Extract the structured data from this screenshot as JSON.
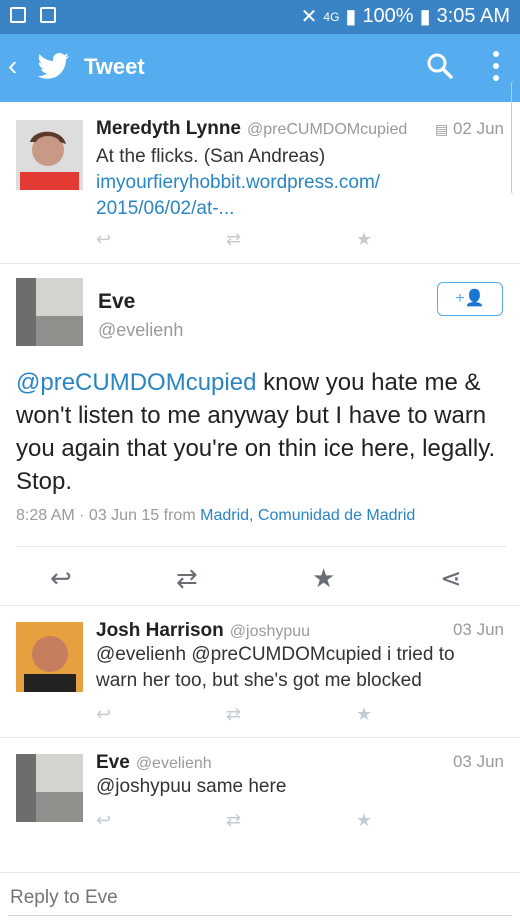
{
  "status": {
    "signal": "4G",
    "battery": "100%",
    "time": "3:05 AM"
  },
  "header": {
    "title": "Tweet"
  },
  "tweets": [
    {
      "name": "Meredyth Lynne",
      "handle": "@preCUMDOMcupied",
      "date": "02 Jun",
      "text": "At the flicks. (San Andreas)",
      "link1": "imyourfieryhobbit.wordpress.com/",
      "link2": "2015/06/02/at-..."
    }
  ],
  "main": {
    "name": "Eve",
    "handle": "@evelienh",
    "mention": "@preCUMDOMcupied",
    "text": " know you hate me & won't listen to me anyway but I  have to warn you again that you're on thin ice here, legally. Stop.",
    "time": "8:28 AM · 03 Jun 15",
    "from": "from",
    "location": "Madrid, Comunidad de Madrid"
  },
  "replies": [
    {
      "name": "Josh Harrison",
      "handle": "@joshypuu",
      "date": "03 Jun",
      "text": "@evelienh @preCUMDOMcupied i tried to warn her too, but she's got me blocked"
    },
    {
      "name": "Eve",
      "handle": "@evelienh",
      "date": "03 Jun",
      "text": "@joshypuu same here"
    }
  ],
  "reply_box": {
    "placeholder": "Reply to Eve"
  },
  "colors": {
    "twitter_blue": "#55acee",
    "status_bar": "#3a83c4",
    "link": "#2a85c4"
  }
}
